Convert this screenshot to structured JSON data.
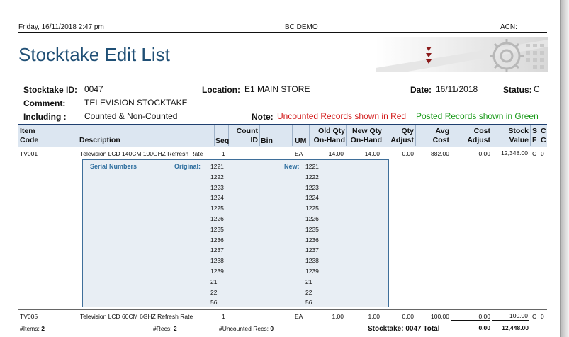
{
  "header": {
    "datetime": "Friday, 16/11/2018  2:47 pm",
    "company": "BC DEMO",
    "acn": "ACN:"
  },
  "title": "Stocktake Edit List",
  "info": {
    "stocktake_id_label": "Stocktake ID:",
    "stocktake_id": "0047",
    "location_label": "Location:",
    "location": "E1  MAIN STORE",
    "date_label": "Date:",
    "date": "16/11/2018",
    "status_label": "Status:",
    "status": "C",
    "comment_label": "Comment:",
    "comment": "TELEVISION STOCKTAKE",
    "including_label": "Including :",
    "including": "Counted & Non-Counted",
    "note_label": "Note:",
    "note_red": "Uncounted Records shown in Red",
    "note_green": "Posted Records shown in Green"
  },
  "columns": {
    "item1": "Item",
    "item2": "Code",
    "description": "Description",
    "seq": "Seq",
    "count1": "Count",
    "count2": "ID",
    "bin": "Bin",
    "um": "UM",
    "oldqty1": "Old Qty",
    "oldqty2": "On-Hand",
    "newqty1": "New Qty",
    "newqty2": "On-Hand",
    "qty1": "Qty",
    "qty2": "Adjust",
    "avg1": "Avg",
    "avg2": "Cost",
    "cost1": "Cost",
    "cost2": "Adjust",
    "stock1": "Stock",
    "stock2": "Value",
    "sf1": "S",
    "sf2": "F",
    "cc1": "C",
    "cc2": "C"
  },
  "rows": [
    {
      "code": "TV001",
      "description": "Television LCD  140CM 100GHZ Refresh Rate",
      "seq": "1",
      "um": "EA",
      "old_qty": "14.00",
      "new_qty": "14.00",
      "qty_adjust": "0.00",
      "avg_cost": "882.00",
      "cost_adjust": "0.00",
      "stock_value": "12,348.00",
      "s": "C",
      "c": "0"
    },
    {
      "code": "TV005",
      "description": "Television LCD  60CM 6GHZ Refresh Rate",
      "seq": "1",
      "um": "EA",
      "old_qty": "1.00",
      "new_qty": "1.00",
      "qty_adjust": "0.00",
      "avg_cost": "100.00",
      "cost_adjust": "0.00",
      "stock_value": "100.00",
      "s": "C",
      "c": "0"
    }
  ],
  "serials": {
    "heading": "Serial Numbers",
    "original_label": "Original:",
    "new_label": "New:",
    "original": [
      "1221",
      "1222",
      "1223",
      "1224",
      "1225",
      "1226",
      "1235",
      "1236",
      "1237",
      "1238",
      "1239",
      "21",
      "22",
      "56"
    ],
    "new": [
      "1221",
      "1222",
      "1223",
      "1224",
      "1225",
      "1226",
      "1235",
      "1236",
      "1237",
      "1238",
      "1239",
      "21",
      "22",
      "56"
    ]
  },
  "footer": {
    "items_label": "#Items:",
    "items": "2",
    "recs_label": "#Recs:",
    "recs": "2",
    "uncounted_label": "#Uncounted Recs:",
    "uncounted": "0",
    "total_label": "Stocktake: 0047 Total",
    "total_cost_adjust": "0.00",
    "total_stock_value": "12,448.00"
  },
  "colors": {
    "title": "#1f4f75",
    "header_fill": "#dce6f1",
    "serial_fill": "#e8eef4",
    "red": "#d21a1a",
    "green": "#1a9a1a",
    "arrow": "#8b1a1a"
  }
}
